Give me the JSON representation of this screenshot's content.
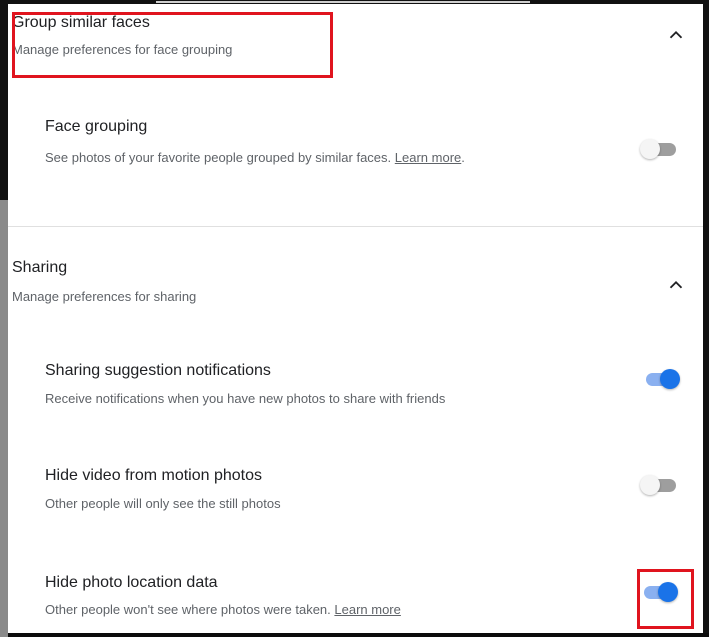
{
  "group_faces": {
    "title": "Group similar faces",
    "subtitle": "Manage preferences for face grouping",
    "expanded_icon": "chevron-up-icon",
    "items": [
      {
        "title": "Face grouping",
        "description": "See photos of your favorite people grouped by similar faces.",
        "link": "Learn more",
        "enabled": false
      }
    ]
  },
  "sharing": {
    "title": "Sharing",
    "subtitle": "Manage preferences for sharing",
    "expanded_icon": "chevron-up-icon",
    "items": [
      {
        "title": "Sharing suggestion notifications",
        "description": "Receive notifications when you have new photos to share with friends",
        "enabled": true
      },
      {
        "title": "Hide video from motion photos",
        "description": "Other people will only see the still photos",
        "enabled": false
      },
      {
        "title": "Hide photo location data",
        "description": "Other people won't see where photos were taken.",
        "link": "Learn more",
        "enabled": true
      }
    ]
  },
  "colors": {
    "toggle_on": "#1a73e8",
    "toggle_on_track": "#8ab0f0",
    "toggle_off_track": "#9e9e9e",
    "highlight": "#e0141e"
  }
}
